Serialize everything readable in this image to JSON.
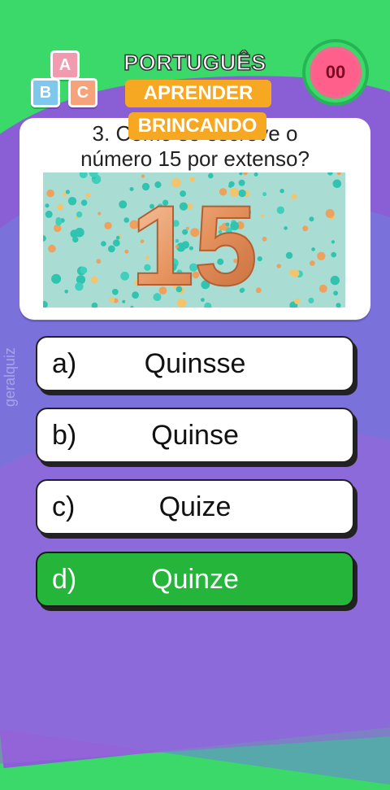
{
  "header": {
    "subject": "PORTUGUÊS",
    "tag_line1": "APRENDER",
    "tag_line2": "BRINCANDO",
    "timer": "00",
    "blocks": [
      "A",
      "B",
      "C"
    ]
  },
  "question": {
    "line1": "3. Como se escreve o",
    "line2": "número 15 por extenso?",
    "image_number": "15"
  },
  "answers": [
    {
      "letter": "a)",
      "text": "Quinsse",
      "correct": false
    },
    {
      "letter": "b)",
      "text": "Quinse",
      "correct": false
    },
    {
      "letter": "c)",
      "text": "Quize",
      "correct": false
    },
    {
      "letter": "d)",
      "text": "Quinze",
      "correct": true
    }
  ],
  "watermark": "geralquiz",
  "colors": {
    "green": "#3ad96a",
    "purple": "#8a5fd6",
    "correct": "#25b53a",
    "orange": "#f7a823",
    "timer": "#ff5f8a"
  }
}
